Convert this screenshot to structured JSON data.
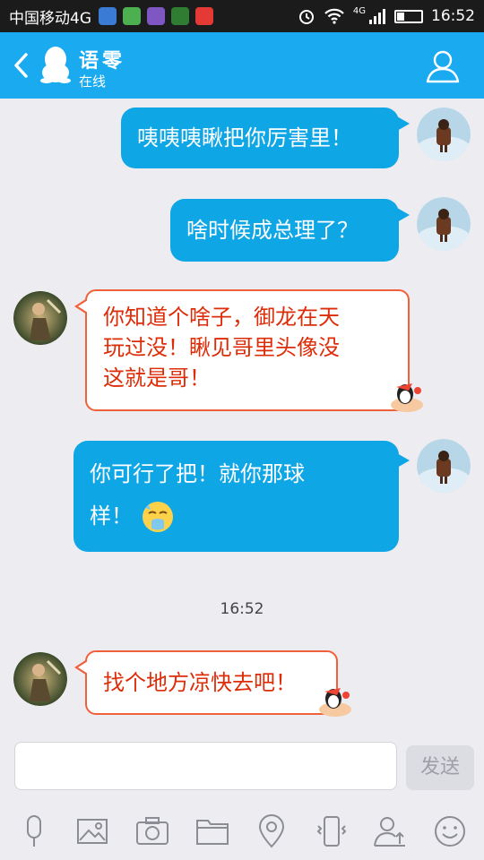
{
  "status_bar": {
    "carrier": "中国移动4G",
    "network": "4G",
    "time": "16:52"
  },
  "header": {
    "contact_name": "语零",
    "contact_status": "在线"
  },
  "messages": [
    {
      "direction": "outgoing",
      "text": "咦咦咦瞅把你厉害里！"
    },
    {
      "direction": "outgoing",
      "text": "啥时候成总理了？"
    },
    {
      "direction": "incoming",
      "lines": [
        "你知道个啥子，御龙在天",
        "玩过没！瞅见哥里头像没",
        "这就是哥！"
      ]
    },
    {
      "direction": "outgoing",
      "lines": [
        "你可行了把！就你那球",
        "样！"
      ],
      "emoji": "sweat-cry-emoji"
    },
    {
      "direction": "incoming",
      "text": "找个地方凉快去吧！"
    }
  ],
  "timestamp": "16:52",
  "input": {
    "value": "",
    "send_label": "发送"
  },
  "toolbar_icons": [
    "microphone-icon",
    "image-icon",
    "camera-icon",
    "folder-icon",
    "location-icon",
    "shake-icon",
    "share-contact-icon",
    "smiley-icon"
  ],
  "colors": {
    "header": "#19aaf0",
    "outgoing_bubble": "#0fa6e6",
    "incoming_border": "#f0603a",
    "incoming_text": "#dd2c08",
    "background": "#ececf1"
  }
}
